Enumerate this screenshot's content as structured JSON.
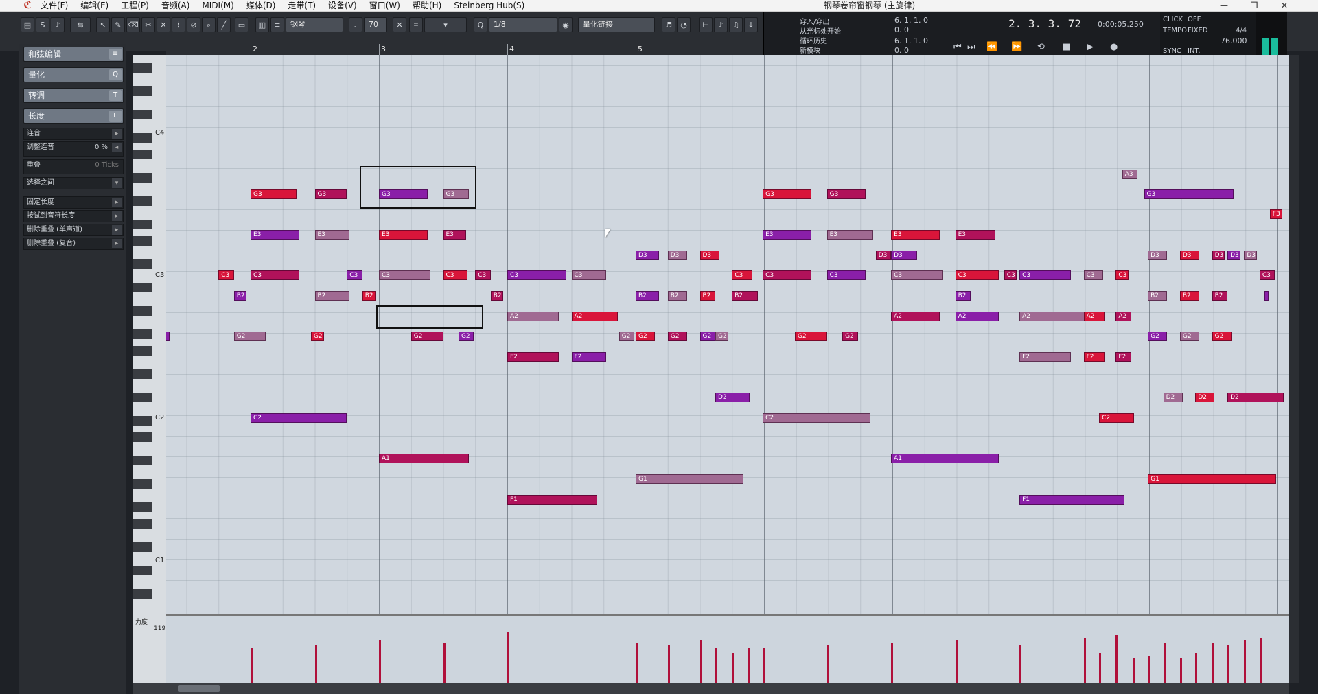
{
  "window": {
    "title": "钢琴卷帘窗钢琴 (主旋律)",
    "menu": [
      "文件(F)",
      "编辑(E)",
      "工程(P)",
      "音频(A)",
      "MIDI(M)",
      "媒体(D)",
      "走带(T)",
      "设备(V)",
      "窗口(W)",
      "帮助(H)",
      "Steinberg Hub(S)"
    ],
    "controls": [
      "—",
      "❐",
      "✕"
    ]
  },
  "toolbar": {
    "track_name": "钢琴",
    "velocity": "70",
    "quantize": "1/8",
    "quantize_mode": "量化链接",
    "transport_left": [
      "穿入/穿出",
      "从光标处开始",
      "循环历史",
      "新模块"
    ],
    "locator_left": "6. 1. 1.    0",
    "locator_right": "6. 1. 1.    0",
    "locator_left2": "0.    0",
    "locator_right2": "0.    0",
    "position": "2. 3. 3.  72",
    "time": "0:00:05.250",
    "click": "CLICK",
    "click_state": "OFF",
    "tempo_label": "TEMPO",
    "tempo_mode": "FIXED",
    "signature": "4/4",
    "tempo": "76.000",
    "sync": "SYNC",
    "sync_mode": "INT."
  },
  "inspector": {
    "sections": [
      {
        "label": "和弦编辑",
        "key": "≡"
      },
      {
        "label": "量化",
        "key": "Q"
      },
      {
        "label": "转调",
        "key": "T"
      },
      {
        "label": "长度",
        "key": "L"
      }
    ],
    "rows": [
      {
        "label": "连音",
        "value": ""
      },
      {
        "label": "调整连音",
        "value": "0 %"
      },
      {
        "label": "重叠",
        "value": "0 Ticks"
      },
      {
        "label": "选择之间",
        "value": ""
      },
      {
        "label": "固定长度",
        "value": ""
      },
      {
        "label": "按试到音符长度",
        "value": ""
      },
      {
        "label": "删除重叠 (单声道)",
        "value": ""
      },
      {
        "label": "删除重叠 (复音)",
        "value": ""
      }
    ]
  },
  "ruler": {
    "bars": [
      "2",
      "3",
      "4",
      "5"
    ]
  },
  "keyboard": {
    "labels": [
      "C4",
      "C3",
      "C2",
      "C1"
    ]
  },
  "notes": [
    {
      "n": "G3",
      "row": "G3",
      "x": 2,
      "w": 0.36
    },
    {
      "n": "G3",
      "row": "G3",
      "x": 2.5,
      "w": 0.25
    },
    {
      "n": "G3",
      "row": "G3",
      "x": 3,
      "w": 0.38
    },
    {
      "n": "G3",
      "row": "G3",
      "x": 3.5,
      "w": 0.2
    },
    {
      "n": "G3",
      "row": "G3",
      "x": 5.99,
      "w": 0.38
    },
    {
      "n": "G3",
      "row": "G3",
      "x": 6.49,
      "w": 0.3
    },
    {
      "n": "G3",
      "row": "G3",
      "x": 8.96,
      "w": 0.7
    },
    {
      "n": "A3",
      "row": "A3",
      "x": 8.79,
      "w": 0.12
    },
    {
      "n": "F3",
      "row": "F3",
      "x": 9.94,
      "w": 0.1
    },
    {
      "n": "F3",
      "row": "F3",
      "x": 10.09,
      "w": 0.06
    },
    {
      "n": "E3",
      "row": "E3",
      "x": 2,
      "w": 0.38
    },
    {
      "n": "E3",
      "row": "E3",
      "x": 2.5,
      "w": 0.27
    },
    {
      "n": "E3",
      "row": "E3",
      "x": 3,
      "w": 0.38
    },
    {
      "n": "E3",
      "row": "E3",
      "x": 3.5,
      "w": 0.18
    },
    {
      "n": "E3",
      "row": "E3",
      "x": 5.99,
      "w": 0.38
    },
    {
      "n": "E3",
      "row": "E3",
      "x": 6.49,
      "w": 0.36
    },
    {
      "n": "E3",
      "row": "E3",
      "x": 6.99,
      "w": 0.38
    },
    {
      "n": "E3",
      "row": "E3",
      "x": 7.49,
      "w": 0.31
    },
    {
      "n": "D3",
      "row": "D3",
      "x": 5,
      "w": 0.18
    },
    {
      "n": "D3",
      "row": "D3",
      "x": 5.25,
      "w": 0.15
    },
    {
      "n": "D3",
      "row": "D3",
      "x": 5.5,
      "w": 0.15
    },
    {
      "n": "D3",
      "row": "D3",
      "x": 6.87,
      "w": 0.12
    },
    {
      "n": "D3",
      "row": "D3",
      "x": 6.99,
      "w": 0.2
    },
    {
      "n": "D3",
      "row": "D3",
      "x": 8.99,
      "w": 0.15
    },
    {
      "n": "D3",
      "row": "D3",
      "x": 9.24,
      "w": 0.15
    },
    {
      "n": "D3",
      "row": "D3",
      "x": 9.49,
      "w": 0.1
    },
    {
      "n": "D3",
      "row": "D3",
      "x": 9.61,
      "w": 0.1
    },
    {
      "n": "D3",
      "row": "D3",
      "x": 9.74,
      "w": 0.1
    },
    {
      "n": "C3",
      "row": "C3",
      "x": 1.75,
      "w": 0.12
    },
    {
      "n": "C3",
      "row": "C3",
      "x": 2,
      "w": 0.38
    },
    {
      "n": "C3",
      "row": "C3",
      "x": 2.75,
      "w": 0.12
    },
    {
      "n": "C3",
      "row": "C3",
      "x": 3,
      "w": 0.4
    },
    {
      "n": "C3",
      "row": "C3",
      "x": 3.5,
      "w": 0.19
    },
    {
      "n": "C3",
      "row": "C3",
      "x": 3.75,
      "w": 0.12
    },
    {
      "n": "C3",
      "row": "C3",
      "x": 4,
      "w": 0.46
    },
    {
      "n": "C3",
      "row": "C3",
      "x": 4.5,
      "w": 0.27
    },
    {
      "n": "C3",
      "row": "C3",
      "x": 5.75,
      "w": 0.16
    },
    {
      "n": "C3",
      "row": "C3",
      "x": 5.99,
      "w": 0.38
    },
    {
      "n": "C3",
      "row": "C3",
      "x": 6.49,
      "w": 0.3
    },
    {
      "n": "C3",
      "row": "C3",
      "x": 6.99,
      "w": 0.4
    },
    {
      "n": "C3",
      "row": "C3",
      "x": 7.49,
      "w": 0.34
    },
    {
      "n": "C3",
      "row": "C3",
      "x": 7.87,
      "w": 0.1
    },
    {
      "n": "C3",
      "row": "C3",
      "x": 7.99,
      "w": 0.4
    },
    {
      "n": "C3",
      "row": "C3",
      "x": 8.49,
      "w": 0.15
    },
    {
      "n": "C3",
      "row": "C3",
      "x": 8.74,
      "w": 0.1
    },
    {
      "n": "C3",
      "row": "C3",
      "x": 9.86,
      "w": 0.12
    },
    {
      "n": "B2",
      "row": "B2",
      "x": 1.87,
      "w": 0.1
    },
    {
      "n": "B2",
      "row": "B2",
      "x": 2.5,
      "w": 0.27
    },
    {
      "n": "B2",
      "row": "B2",
      "x": 2.87,
      "w": 0.11
    },
    {
      "n": "B2",
      "row": "B2",
      "x": 3.87,
      "w": 0.1
    },
    {
      "n": "B2",
      "row": "B2",
      "x": 5,
      "w": 0.18
    },
    {
      "n": "B2",
      "row": "B2",
      "x": 5.25,
      "w": 0.15
    },
    {
      "n": "B2",
      "row": "B2",
      "x": 5.5,
      "w": 0.12
    },
    {
      "n": "B2",
      "row": "B2",
      "x": 5.75,
      "w": 0.2
    },
    {
      "n": "B2",
      "row": "B2",
      "x": 7.49,
      "w": 0.12
    },
    {
      "n": "B2",
      "row": "B2",
      "x": 8.99,
      "w": 0.15
    },
    {
      "n": "B2",
      "row": "B2",
      "x": 9.24,
      "w": 0.15
    },
    {
      "n": "B2",
      "row": "B2",
      "x": 9.49,
      "w": 0.12
    },
    {
      "n": "",
      "row": "B2",
      "x": 9.9,
      "w": 0.03
    },
    {
      "n": "A2",
      "row": "A2",
      "x": 4,
      "w": 0.4
    },
    {
      "n": "A2",
      "row": "A2",
      "x": 4.5,
      "w": 0.36
    },
    {
      "n": "A2",
      "row": "A2",
      "x": 6.99,
      "w": 0.38
    },
    {
      "n": "A2",
      "row": "A2",
      "x": 7.49,
      "w": 0.34
    },
    {
      "n": "A2",
      "row": "A2",
      "x": 7.99,
      "w": 0.52
    },
    {
      "n": "A2",
      "row": "A2",
      "x": 8.49,
      "w": 0.16
    },
    {
      "n": "A2",
      "row": "A2",
      "x": 8.74,
      "w": 0.12
    },
    {
      "n": "G2",
      "row": "G2",
      "x": 1.25,
      "w": 0.12
    },
    {
      "n": "G2",
      "row": "G2",
      "x": 1.87,
      "w": 0.25
    },
    {
      "n": "G2",
      "row": "G2",
      "x": 2.47,
      "w": 0.1
    },
    {
      "n": "G2",
      "row": "G2",
      "x": 3.25,
      "w": 0.25
    },
    {
      "n": "G2",
      "row": "G2",
      "x": 3.62,
      "w": 0.12
    },
    {
      "n": "G2",
      "row": "G2",
      "x": 4.87,
      "w": 0.12
    },
    {
      "n": "G2",
      "row": "G2",
      "x": 5,
      "w": 0.15
    },
    {
      "n": "G2",
      "row": "G2",
      "x": 5.25,
      "w": 0.15
    },
    {
      "n": "G2",
      "row": "G2",
      "x": 5.5,
      "w": 0.15
    },
    {
      "n": "G2",
      "row": "G2",
      "x": 5.62,
      "w": 0.1
    },
    {
      "n": "G2",
      "row": "G2",
      "x": 6.24,
      "w": 0.25
    },
    {
      "n": "G2",
      "row": "G2",
      "x": 6.61,
      "w": 0.12
    },
    {
      "n": "G2",
      "row": "G2",
      "x": 8.99,
      "w": 0.15
    },
    {
      "n": "G2",
      "row": "G2",
      "x": 9.24,
      "w": 0.15
    },
    {
      "n": "G2",
      "row": "G2",
      "x": 9.49,
      "w": 0.15
    },
    {
      "n": "F2",
      "row": "F2",
      "x": 4,
      "w": 0.4
    },
    {
      "n": "F2",
      "row": "F2",
      "x": 4.5,
      "w": 0.27
    },
    {
      "n": "F2",
      "row": "F2",
      "x": 7.99,
      "w": 0.4
    },
    {
      "n": "F2",
      "row": "F2",
      "x": 8.49,
      "w": 0.16
    },
    {
      "n": "F2",
      "row": "F2",
      "x": 8.74,
      "w": 0.12
    },
    {
      "n": "D2",
      "row": "D2",
      "x": 5.62,
      "w": 0.27
    },
    {
      "n": "D2",
      "row": "D2",
      "x": 9.11,
      "w": 0.15
    },
    {
      "n": "D2",
      "row": "D2",
      "x": 9.36,
      "w": 0.15
    },
    {
      "n": "D2",
      "row": "D2",
      "x": 9.61,
      "w": 0.44
    },
    {
      "n": "C2",
      "row": "C2",
      "x": 2,
      "w": 0.75
    },
    {
      "n": "C2",
      "row": "C2",
      "x": 5.99,
      "w": 0.84
    },
    {
      "n": "C2",
      "row": "C2",
      "x": 8.61,
      "w": 0.27
    },
    {
      "n": "A1",
      "row": "A1",
      "x": 3,
      "w": 0.7
    },
    {
      "n": "A1",
      "row": "A1",
      "x": 6.99,
      "w": 0.84
    },
    {
      "n": "G1",
      "row": "G1",
      "x": 5,
      "w": 0.84
    },
    {
      "n": "G1",
      "row": "G1",
      "x": 8.99,
      "w": 1.0
    },
    {
      "n": "F1",
      "row": "F1",
      "x": 4,
      "w": 0.7
    },
    {
      "n": "F1",
      "row": "F1",
      "x": 7.99,
      "w": 0.82
    }
  ],
  "velocity": {
    "label": "力度",
    "max": "119",
    "bars": [
      [
        2,
        70
      ],
      [
        2.5,
        75
      ],
      [
        3,
        85
      ],
      [
        3.5,
        80
      ],
      [
        4,
        100
      ],
      [
        5,
        80
      ],
      [
        5.25,
        75
      ],
      [
        5.5,
        85
      ],
      [
        5.62,
        70
      ],
      [
        5.75,
        60
      ],
      [
        5.87,
        70
      ],
      [
        5.99,
        70
      ],
      [
        6.49,
        75
      ],
      [
        6.99,
        80
      ],
      [
        7.49,
        85
      ],
      [
        7.99,
        75
      ],
      [
        8.49,
        90
      ],
      [
        8.61,
        60
      ],
      [
        8.74,
        95
      ],
      [
        8.87,
        50
      ],
      [
        8.99,
        55
      ],
      [
        9.11,
        80
      ],
      [
        9.24,
        50
      ],
      [
        9.36,
        60
      ],
      [
        9.49,
        80
      ],
      [
        9.61,
        75
      ],
      [
        9.74,
        85
      ],
      [
        9.86,
        90
      ]
    ]
  },
  "colors": {
    "note_hot": "#d9153a",
    "note_mid": "#b0125a",
    "note_purple": "#8a1fa8",
    "note_pale": "#a06a92"
  }
}
